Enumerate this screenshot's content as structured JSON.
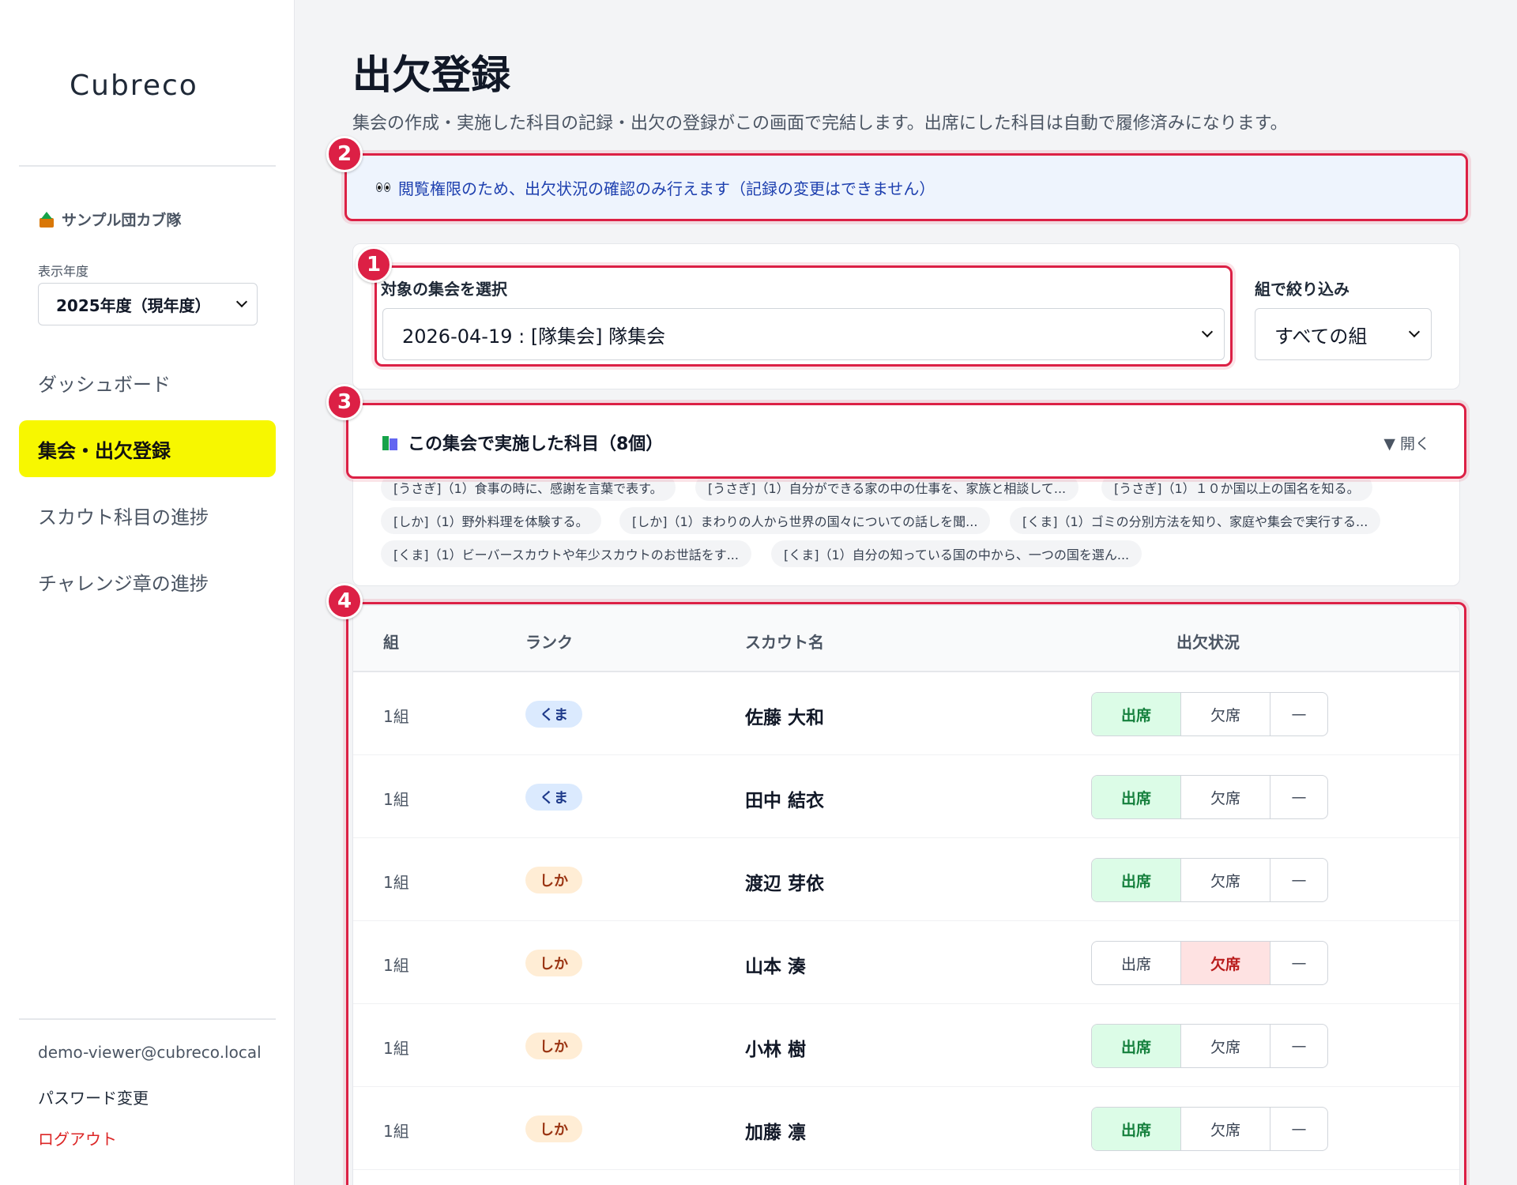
{
  "sidebar": {
    "logo": "Cubreco",
    "troop_name": "サンプル団カブ隊",
    "year_label": "表示年度",
    "year_value": "2025年度（現年度）",
    "nav": [
      {
        "label": "ダッシュボード",
        "active": false
      },
      {
        "label": "集会・出欠登録",
        "active": true
      },
      {
        "label": "スカウト科目の進捗",
        "active": false
      },
      {
        "label": "チャレンジ章の進捗",
        "active": false
      }
    ],
    "user_email": "demo-viewer@cubreco.local",
    "password_change": "パスワード変更",
    "logout": "ログアウト"
  },
  "page": {
    "title": "出欠登録",
    "subtitle": "集会の作成・実施した科目の記録・出欠の登録がこの画面で完結します。出席にした科目は自動で履修済みになります。"
  },
  "notice": {
    "text": "閲覧権限のため、出欠状況の確認のみ行えます（記録の変更はできません）"
  },
  "filters": {
    "meeting_label": "対象の集会を選択",
    "meeting_value": "2026-04-19 : [隊集会] 隊集会",
    "group_label": "組で絞り込み",
    "group_value": "すべての組"
  },
  "subjects": {
    "title": "この集会で実施した科目（8個）",
    "toggle": "▼ 開く",
    "tags": [
      "[うさぎ]（1）食事の時に、感謝を言葉で表す。",
      "[うさぎ]（1）自分ができる家の中の仕事を、家族と相談して...",
      "[うさぎ]（1）１０か国以上の国名を知る。",
      "[しか]（1）野外料理を体験する。",
      "[しか]（1）まわりの人から世界の国々についての話しを聞...",
      "[くま]（1）ゴミの分別方法を知り、家庭や集会で実行する...",
      "[くま]（1）ビーバースカウトや年少スカウトのお世話をす...",
      "[くま]（1）自分の知っている国の中から、一つの国を選ん..."
    ]
  },
  "table": {
    "headers": {
      "group": "組",
      "rank": "ランク",
      "name": "スカウト名",
      "status": "出欠状況"
    },
    "status_labels": {
      "present": "出席",
      "absent": "欠席",
      "none": "—"
    },
    "rows": [
      {
        "group": "1組",
        "rank": "くま",
        "rank_class": "kuma",
        "name": "佐藤 大和",
        "status": "present"
      },
      {
        "group": "1組",
        "rank": "くま",
        "rank_class": "kuma",
        "name": "田中 結衣",
        "status": "present"
      },
      {
        "group": "1組",
        "rank": "しか",
        "rank_class": "shika",
        "name": "渡辺 芽依",
        "status": "present"
      },
      {
        "group": "1組",
        "rank": "しか",
        "rank_class": "shika",
        "name": "山本 湊",
        "status": "absent"
      },
      {
        "group": "1組",
        "rank": "しか",
        "rank_class": "shika",
        "name": "小林 樹",
        "status": "present"
      },
      {
        "group": "1組",
        "rank": "しか",
        "rank_class": "shika",
        "name": "加藤 凛",
        "status": "present"
      }
    ]
  },
  "callouts": [
    "1",
    "2",
    "3",
    "4"
  ],
  "colors": {
    "accent": "#f7f700",
    "callout": "#dc2045",
    "present": "#15803d",
    "absent": "#b91c1c"
  }
}
